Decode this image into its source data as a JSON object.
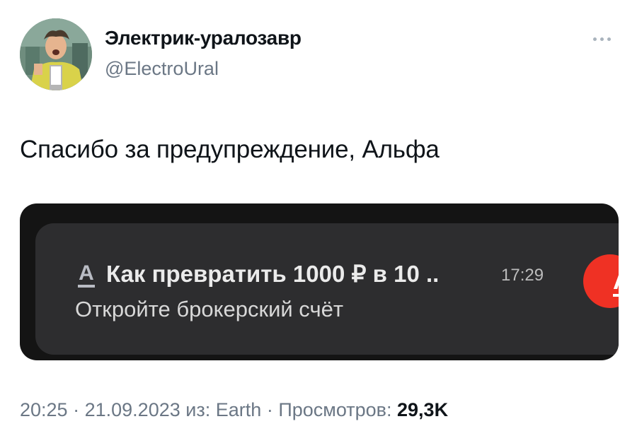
{
  "author": {
    "name": "Электрик-уралозавр",
    "handle": "@ElectroUral"
  },
  "tweet": {
    "text": "Спасибо за предупреждение, Альфа"
  },
  "notification": {
    "app_letter": "А",
    "title": "Как превратить 1000 ₽ в 10 ..",
    "time": "17:29",
    "body": "Откройте брокерский счёт",
    "app_icon_color": "#ef3124"
  },
  "meta": {
    "time": "20:25",
    "date": "21.09.2023",
    "source_prefix": "из:",
    "source": "Earth",
    "views_label": "Просмотров:",
    "views": "29,3K",
    "separator": "·"
  },
  "icons": [
    "more-icon"
  ]
}
